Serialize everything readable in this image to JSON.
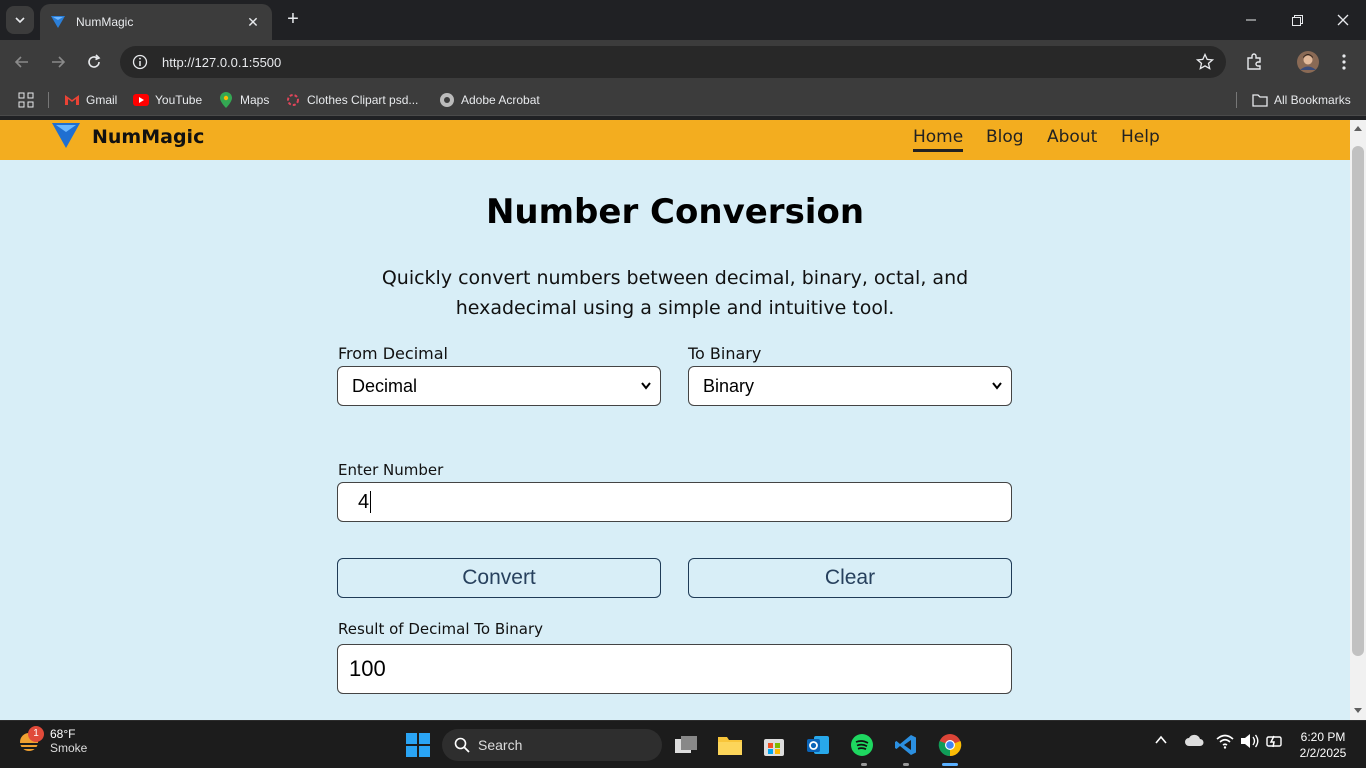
{
  "browser": {
    "tab_title": "NumMagic",
    "url": "http://127.0.0.1:5500",
    "bookmarks": [
      {
        "label": "Gmail",
        "icon": "gmail-icon"
      },
      {
        "label": "YouTube",
        "icon": "youtube-icon"
      },
      {
        "label": "Maps",
        "icon": "maps-icon"
      },
      {
        "label": "Clothes Clipart psd...",
        "icon": "clipart-icon"
      },
      {
        "label": "Adobe Acrobat",
        "icon": "acrobat-icon"
      }
    ],
    "all_bookmarks_label": "All Bookmarks"
  },
  "site": {
    "brand": "NumMagic",
    "nav": [
      {
        "label": "Home",
        "active": true
      },
      {
        "label": "Blog",
        "active": false
      },
      {
        "label": "About",
        "active": false
      },
      {
        "label": "Help",
        "active": false
      }
    ]
  },
  "main": {
    "title": "Number Conversion",
    "description": "Quickly convert numbers between decimal, binary, octal, and hexadecimal using a simple and intuitive tool.",
    "from_label": "From Decimal",
    "from_value": "Decimal",
    "to_label": "To Binary",
    "to_value": "Binary",
    "enter_label": "Enter Number",
    "enter_value": "4",
    "convert_label": "Convert",
    "clear_label": "Clear",
    "result_label": "Result of Decimal To Binary",
    "result_value": "100"
  },
  "taskbar": {
    "weather_temp": "68°F",
    "weather_cond": "Smoke",
    "weather_badge": "1",
    "search_label": "Search",
    "time": "6:20 PM",
    "date": "2/2/2025"
  },
  "colors": {
    "nav_bg": "#f3ad1f",
    "page_bg": "#d8eef7",
    "button_border": "#1f3b57"
  }
}
